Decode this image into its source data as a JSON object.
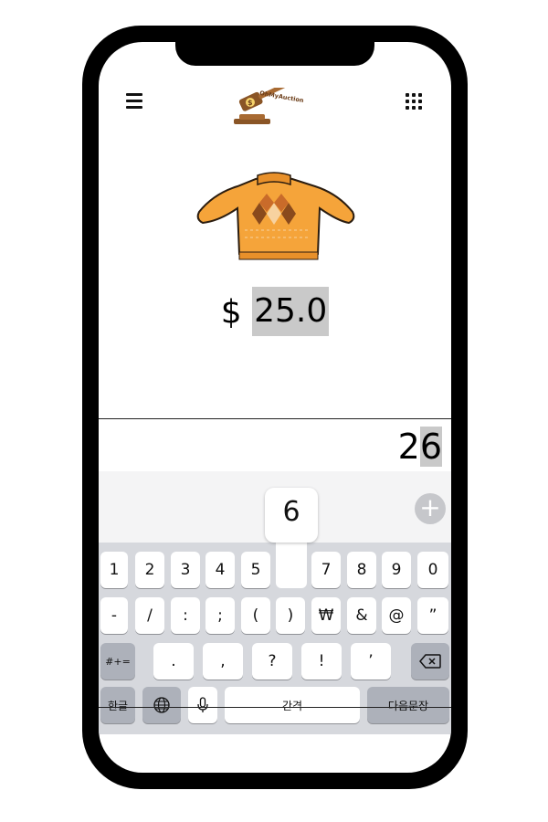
{
  "app": {
    "logo_text": "OhMyAuction"
  },
  "header": {
    "menu_icon": "hamburger-menu-icon",
    "apps_icon": "grid-dots-icon"
  },
  "product": {
    "image": "orange-argyle-sweater",
    "currency": "$",
    "price": "25.0"
  },
  "bid_input": {
    "value_prefix": "2",
    "value_selected": "6"
  },
  "keyboard": {
    "preview_key": "6",
    "plus_icon": "plus-circle-icon",
    "row1": [
      "1",
      "2",
      "3",
      "4",
      "5",
      "",
      "7",
      "8",
      "9",
      "0"
    ],
    "row2": [
      "-",
      "/",
      ":",
      ";",
      "(",
      ")",
      "₩",
      "&",
      "@",
      "”"
    ],
    "row3_left": "#+=",
    "row3": [
      ".",
      ",",
      "?",
      "!",
      "’"
    ],
    "backspace_icon": "backspace-icon",
    "lang": "한글",
    "globe_icon": "globe-icon",
    "mic_icon": "microphone-icon",
    "space": "간격",
    "return": "다음문장"
  },
  "colors": {
    "selection": "#c9c9c9",
    "accent": "#f5a43a",
    "keyboard_bg": "#d6d8dd"
  }
}
